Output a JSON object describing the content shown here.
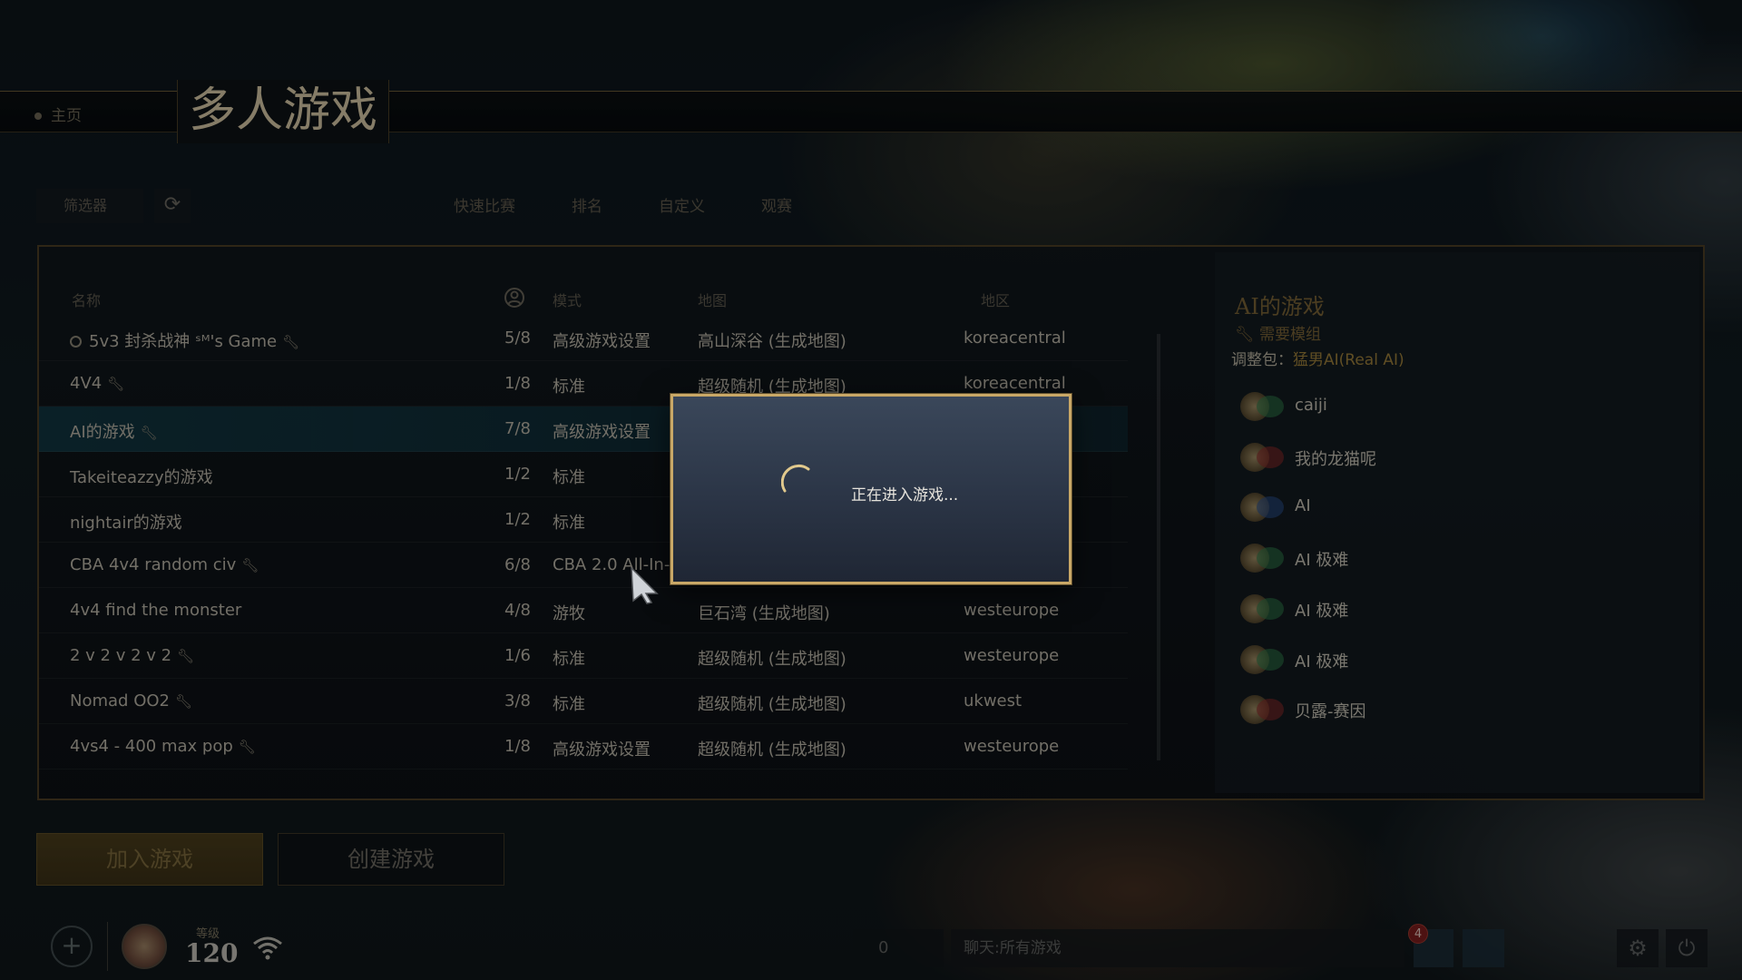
{
  "topnav": {
    "home": "主页",
    "title": "多人游戏",
    "tabs": [
      "快速比赛",
      "排名",
      "自定义",
      "观赛"
    ]
  },
  "filter": {
    "label": "筛选器"
  },
  "table": {
    "headers": {
      "name": "名称",
      "mode": "模式",
      "map": "地图",
      "region": "地区"
    },
    "rows": [
      {
        "name": "5v3  封杀战神 ˢᴹ's Game",
        "players": "5/8",
        "mode": "高级游戏设置",
        "map": "高山深谷 (生成地图)",
        "region": "koreacentral",
        "globe": true,
        "wrench": true
      },
      {
        "name": "4V4",
        "players": "1/8",
        "mode": "标准",
        "map": "超级随机 (生成地图)",
        "region": "koreacentral",
        "globe": false,
        "wrench": true
      },
      {
        "name": "AI的游戏",
        "players": "7/8",
        "mode": "高级游戏设置",
        "map": "",
        "region": "",
        "globe": false,
        "wrench": true,
        "selected": true
      },
      {
        "name": "Takeiteazzy的游戏",
        "players": "1/2",
        "mode": "标准",
        "map": "",
        "region": "",
        "globe": false,
        "wrench": false
      },
      {
        "name": "nightair的游戏",
        "players": "1/2",
        "mode": "标准",
        "map": "",
        "region": "",
        "globe": false,
        "wrench": false
      },
      {
        "name": "CBA 4v4 random civ",
        "players": "6/8",
        "mode": "CBA 2.0 All-In-..",
        "map": "",
        "region": "",
        "globe": false,
        "wrench": true
      },
      {
        "name": "4v4 find the monster",
        "players": "4/8",
        "mode": "游牧",
        "map": "巨石湾 (生成地图)",
        "region": "westeurope",
        "globe": false,
        "wrench": false
      },
      {
        "name": "2 v 2 v 2 v 2",
        "players": "1/6",
        "mode": "标准",
        "map": "超级随机 (生成地图)",
        "region": "westeurope",
        "globe": false,
        "wrench": true
      },
      {
        "name": "Nomad OO2",
        "players": "3/8",
        "mode": "标准",
        "map": "超级随机 (生成地图)",
        "region": "ukwest",
        "globe": false,
        "wrench": true
      },
      {
        "name": "4vs4 - 400 max pop",
        "players": "1/8",
        "mode": "高级游戏设置",
        "map": "超级随机 (生成地图)",
        "region": "westeurope",
        "globe": false,
        "wrench": true
      }
    ]
  },
  "details": {
    "title": "AI的游戏",
    "requires_mod": "需要模组",
    "mod_label": "调整包：",
    "mod_name": "猛男AI(Real AI)",
    "players": [
      {
        "name": "caiji",
        "flag_color": "#2e7a4a"
      },
      {
        "name": "我的龙猫呢",
        "flag_color": "#8a2a2a"
      },
      {
        "name": "AI",
        "flag_color": "#2a4f8a"
      },
      {
        "name": "AI 极难",
        "flag_color": "#2e7a4a"
      },
      {
        "name": "AI 极难",
        "flag_color": "#2e7a4a"
      },
      {
        "name": "AI 极难",
        "flag_color": "#2e7a4a"
      },
      {
        "name": "贝露-赛因",
        "flag_color": "#8a2a2a"
      }
    ]
  },
  "actions": {
    "join": "加入游戏",
    "create": "创建游戏"
  },
  "bottombar": {
    "level_label": "等级",
    "level": "120",
    "friends_count": "0",
    "chat_placeholder": "聊天:所有游戏",
    "notifications": "4"
  },
  "modal": {
    "message": "正在进入游戏..."
  },
  "colors": {
    "accent_gold": "#c9a867",
    "selected_row": "#123a46",
    "mod_gold": "#9c7f3a"
  }
}
